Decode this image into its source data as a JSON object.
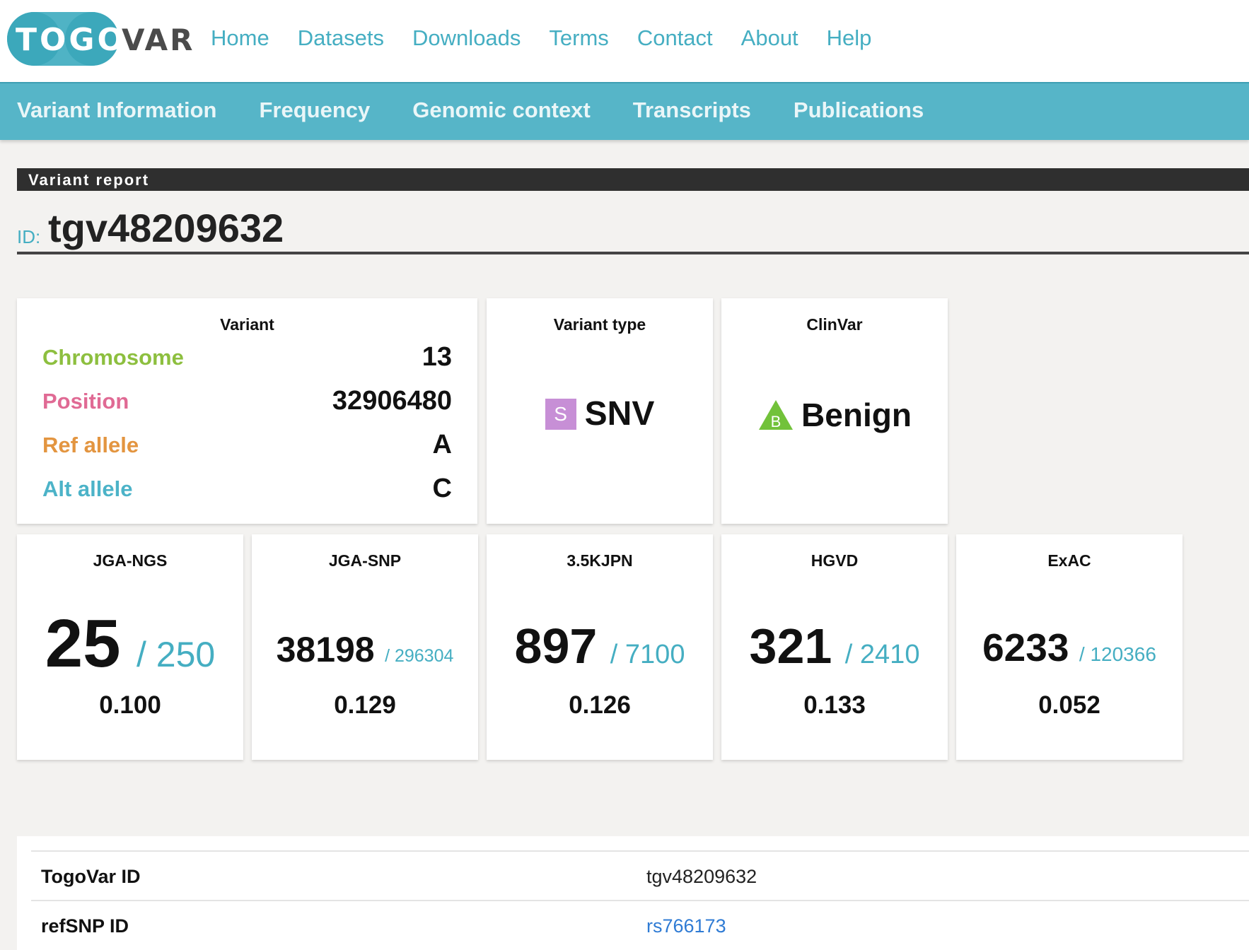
{
  "app": {
    "logo_left": "TOGO",
    "logo_right": "VAR",
    "nav": [
      "Home",
      "Datasets",
      "Downloads",
      "Terms",
      "Contact",
      "About",
      "Help"
    ]
  },
  "section_nav": [
    "Variant Information",
    "Frequency",
    "Genomic context",
    "Transcripts",
    "Publications"
  ],
  "report": {
    "title": "Variant report",
    "id_prefix": "ID:",
    "id_value": "tgv48209632"
  },
  "variant_card": {
    "title": "Variant",
    "rows": [
      {
        "label": "Chromosome",
        "value": "13",
        "color": "#8dbf3f"
      },
      {
        "label": "Position",
        "value": "32906480",
        "color": "#e06a94"
      },
      {
        "label": "Ref allele",
        "value": "A",
        "color": "#e39540"
      },
      {
        "label": "Alt allele",
        "value": "C",
        "color": "#4cb3c8"
      }
    ]
  },
  "variant_type_card": {
    "title": "Variant type",
    "badge": "S",
    "badge_color": "#c78fd6",
    "value": "SNV"
  },
  "clinvar_card": {
    "title": "ClinVar",
    "badge": "B",
    "badge_color": "#72c23a",
    "icon": "triangle-icon",
    "value": "Benign"
  },
  "frequency_cards": [
    {
      "title": "JGA-NGS",
      "count": "25",
      "total": "/ 250",
      "freq": "0.100"
    },
    {
      "title": "JGA-SNP",
      "count": "38198",
      "total": "/ 296304",
      "freq": "0.129"
    },
    {
      "title": "3.5KJPN",
      "count": "897",
      "total": "/ 7100",
      "freq": "0.126"
    },
    {
      "title": "HGVD",
      "count": "321",
      "total": "/ 2410",
      "freq": "0.133"
    },
    {
      "title": "ExAC",
      "count": "6233",
      "total": "/ 120366",
      "freq": "0.052"
    }
  ],
  "info_table": [
    {
      "key": "TogoVar ID",
      "value": "tgv48209632",
      "link": false
    },
    {
      "key": "refSNP ID",
      "value": "rs766173",
      "link": true
    }
  ],
  "colors": {
    "accent": "#45aec2",
    "nav_bar": "#56b5c8",
    "report_bar": "#2f2f2f",
    "link": "#2f7bd4"
  }
}
